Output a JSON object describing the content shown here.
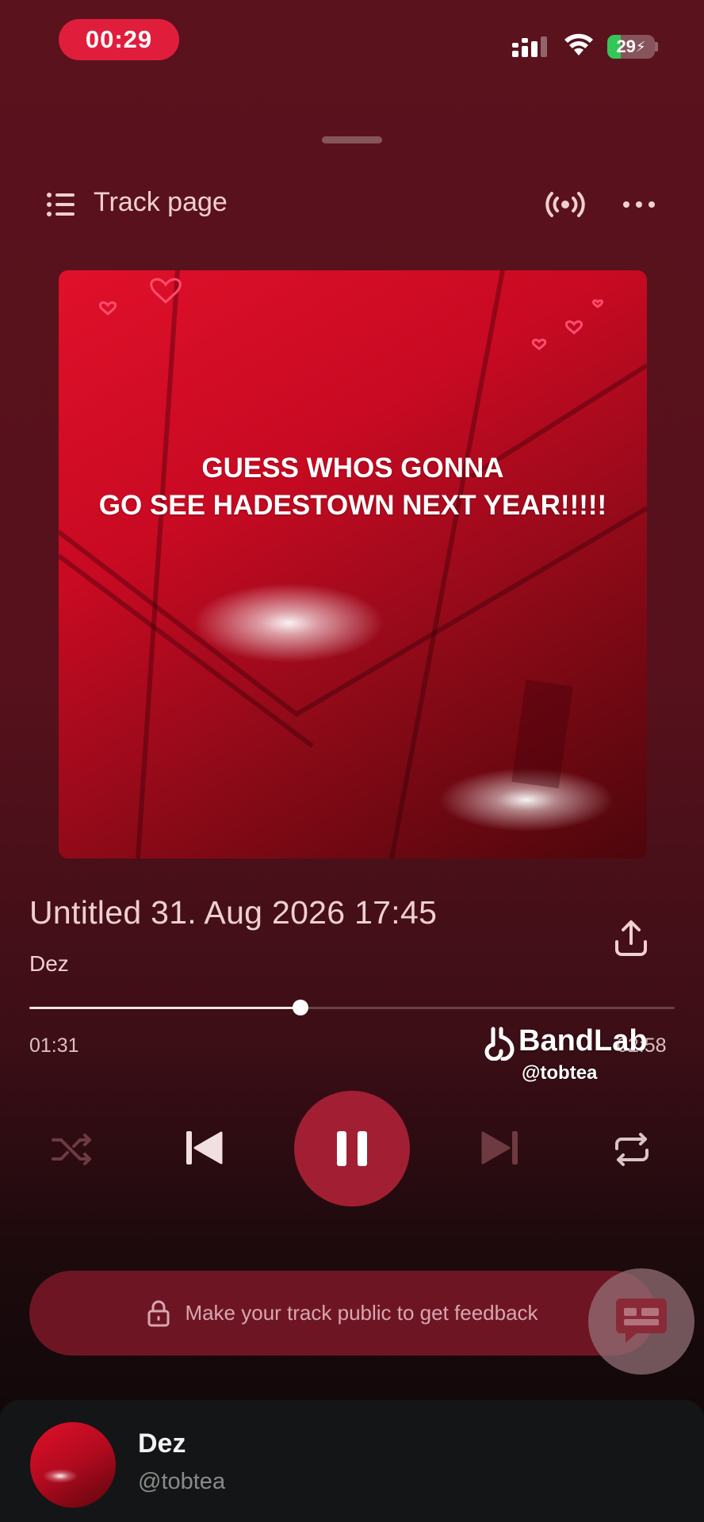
{
  "status_bar": {
    "time": "00:29",
    "battery_percent": 29,
    "battery_label": "29",
    "icons": [
      "cellular-signal-icon",
      "wifi-icon",
      "battery-charging-icon"
    ]
  },
  "header": {
    "title": "Track page",
    "icons": [
      "list-icon",
      "broadcast-icon",
      "more-icon"
    ]
  },
  "artwork": {
    "caption_line1": "GUESS WHOS GONNA",
    "caption_line2": "GO SEE HADESTOWN NEXT YEAR!!!!!"
  },
  "track": {
    "title": "Untitled 31. Aug 2026 17:45",
    "artist": "Dez",
    "share_icon": "share-icon"
  },
  "playback": {
    "elapsed": "01:31",
    "total": "02:58",
    "progress": 0.42
  },
  "watermark": {
    "brand": "BandLab",
    "handle": "@tobtea"
  },
  "controls": {
    "icons": [
      "shuffle-icon",
      "previous-icon",
      "pause-icon",
      "next-icon",
      "repeat-icon"
    ]
  },
  "feedback": {
    "text": "Make your track public to get feedback",
    "icon": "lock-icon"
  },
  "profile": {
    "name": "Dez",
    "handle": "@tobtea"
  },
  "colors": {
    "accent": "#a21f33",
    "background_top": "#5a121d",
    "status_pill": "#e01e3c"
  }
}
